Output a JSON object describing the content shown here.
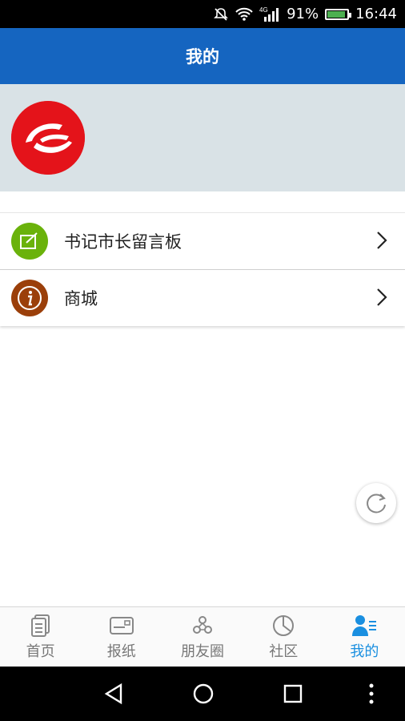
{
  "status_bar": {
    "battery": "91%",
    "time": "16:44",
    "network": "4G"
  },
  "header": {
    "title": "我的"
  },
  "menu": {
    "items": [
      {
        "label": "书记市长留言板",
        "icon": "edit-note-icon",
        "color": "#6ab20b"
      },
      {
        "label": "商城",
        "icon": "info-icon",
        "color": "#9b3f0a"
      }
    ]
  },
  "tabs": [
    {
      "label": "首页",
      "icon": "document-icon",
      "active": false
    },
    {
      "label": "报纸",
      "icon": "newspaper-icon",
      "active": false
    },
    {
      "label": "朋友圈",
      "icon": "friends-circle-icon",
      "active": false
    },
    {
      "label": "社区",
      "icon": "pie-chart-icon",
      "active": false
    },
    {
      "label": "我的",
      "icon": "user-list-icon",
      "active": true
    }
  ],
  "colors": {
    "primary": "#1565c0",
    "profile_bg": "#d9e2e6",
    "active_tab": "#1a8fe0",
    "logo_red": "#e4131a"
  }
}
